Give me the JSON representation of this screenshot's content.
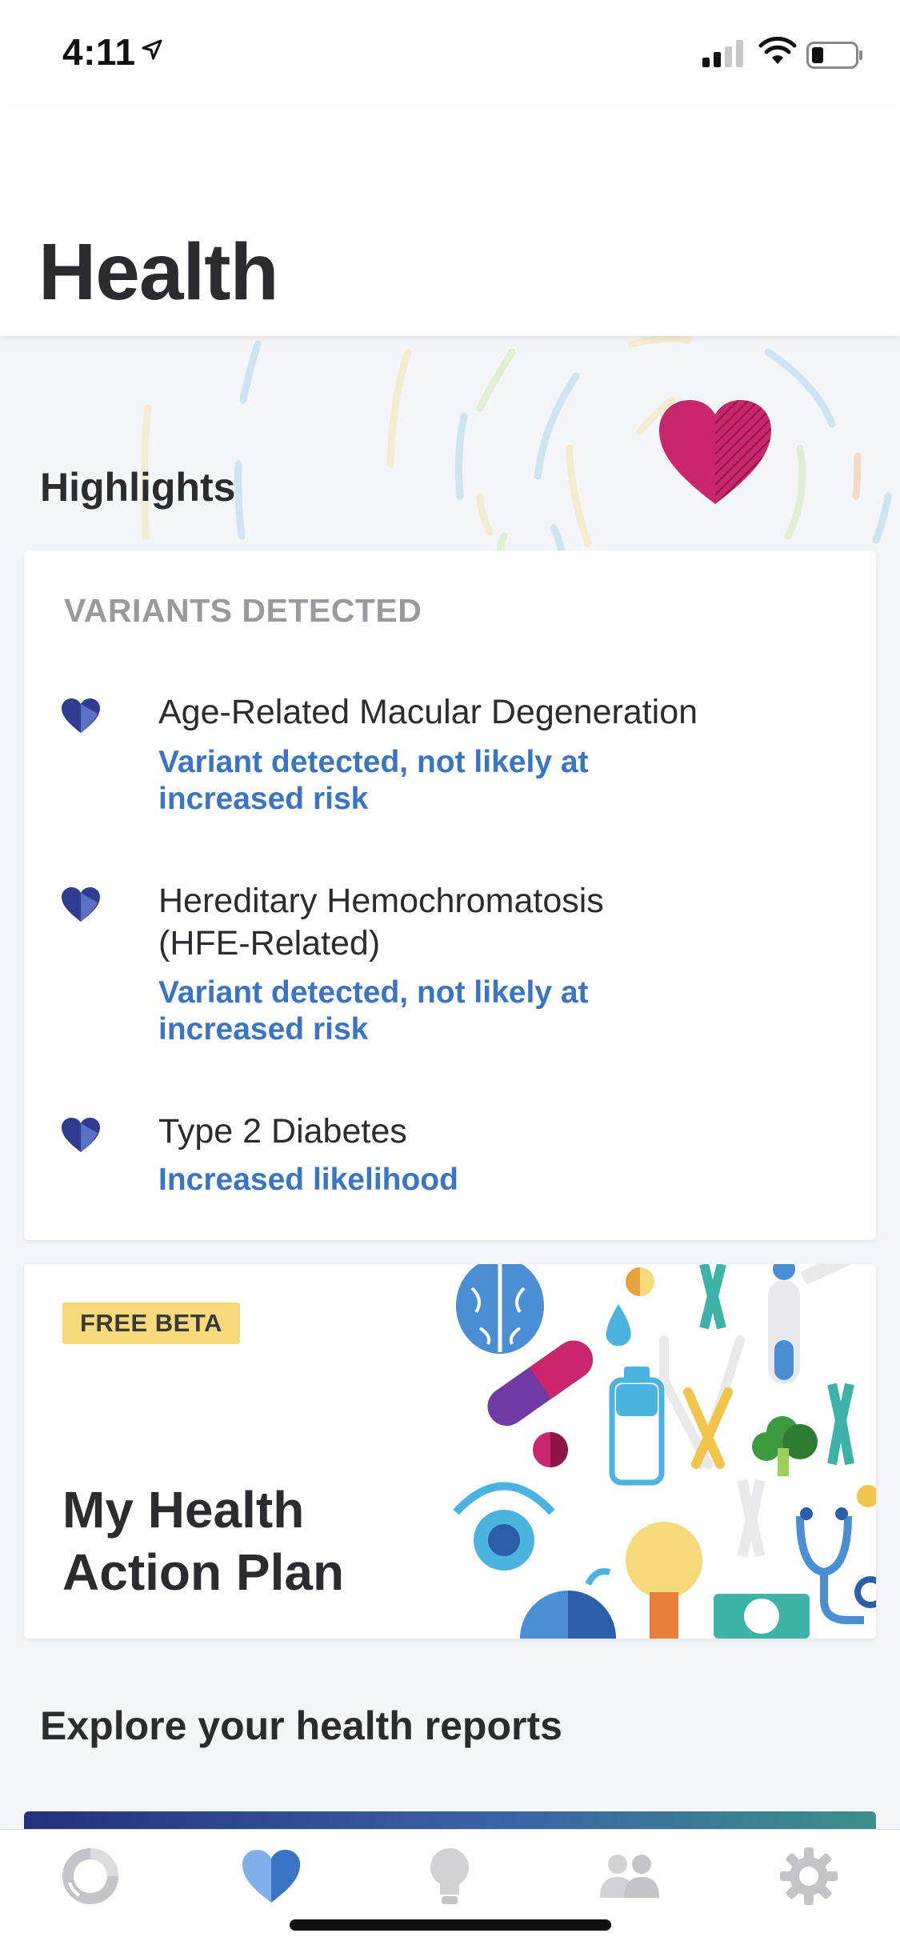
{
  "status_bar": {
    "time": "4:11"
  },
  "header": {
    "title": "Health"
  },
  "highlights": {
    "title": "Highlights"
  },
  "variants_card": {
    "heading": "VARIANTS DETECTED",
    "items": [
      {
        "name": "Age-Related Macular Degeneration",
        "status": "Variant detected, not likely at increased risk"
      },
      {
        "name": "Hereditary Hemochromatosis (HFE-Related)",
        "status": "Variant detected, not likely at increased risk"
      },
      {
        "name": "Type 2 Diabetes",
        "status": "Increased likelihood"
      }
    ]
  },
  "plan_card": {
    "badge": "FREE BETA",
    "title": "My Health Action Plan"
  },
  "explore": {
    "title": "Explore your health reports"
  },
  "tab_bar": {
    "tabs": [
      {
        "icon": "ancestry-chart-icon",
        "active": false
      },
      {
        "icon": "health-heart-icon",
        "active": true
      },
      {
        "icon": "lightbulb-icon",
        "active": false
      },
      {
        "icon": "relatives-icon",
        "active": false
      },
      {
        "icon": "settings-gear-icon",
        "active": false
      }
    ]
  },
  "colors": {
    "accent": "#3a74c4",
    "heart_pink": "#c9266b",
    "badge": "#f6d97a",
    "variant_icon": "#2e3d8f"
  }
}
